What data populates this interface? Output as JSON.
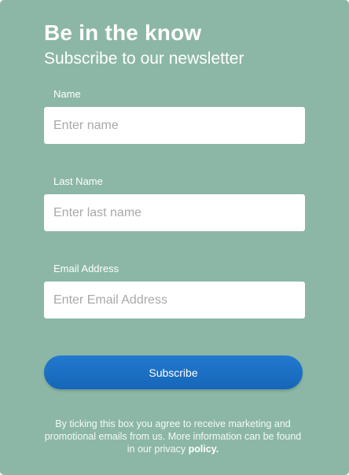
{
  "form": {
    "title": "Be in the know",
    "subtitle": "Subscribe to our newsletter",
    "fields": [
      {
        "label": "Name",
        "placeholder": "Enter name",
        "value": ""
      },
      {
        "label": "Last Name",
        "placeholder": "Enter last name",
        "value": ""
      },
      {
        "label": "Email Address",
        "placeholder": "Enter Email Address",
        "value": ""
      }
    ],
    "submit_label": "Subscribe",
    "disclaimer_text": "By ticking this box you agree to receive marketing and promotional emails from us. More information can be found in our privacy",
    "policy_link_text": "policy."
  },
  "colors": {
    "background": "#8cb7a6",
    "button": "#1e73c8",
    "input_background": "#ffffff",
    "text": "#ffffff"
  }
}
